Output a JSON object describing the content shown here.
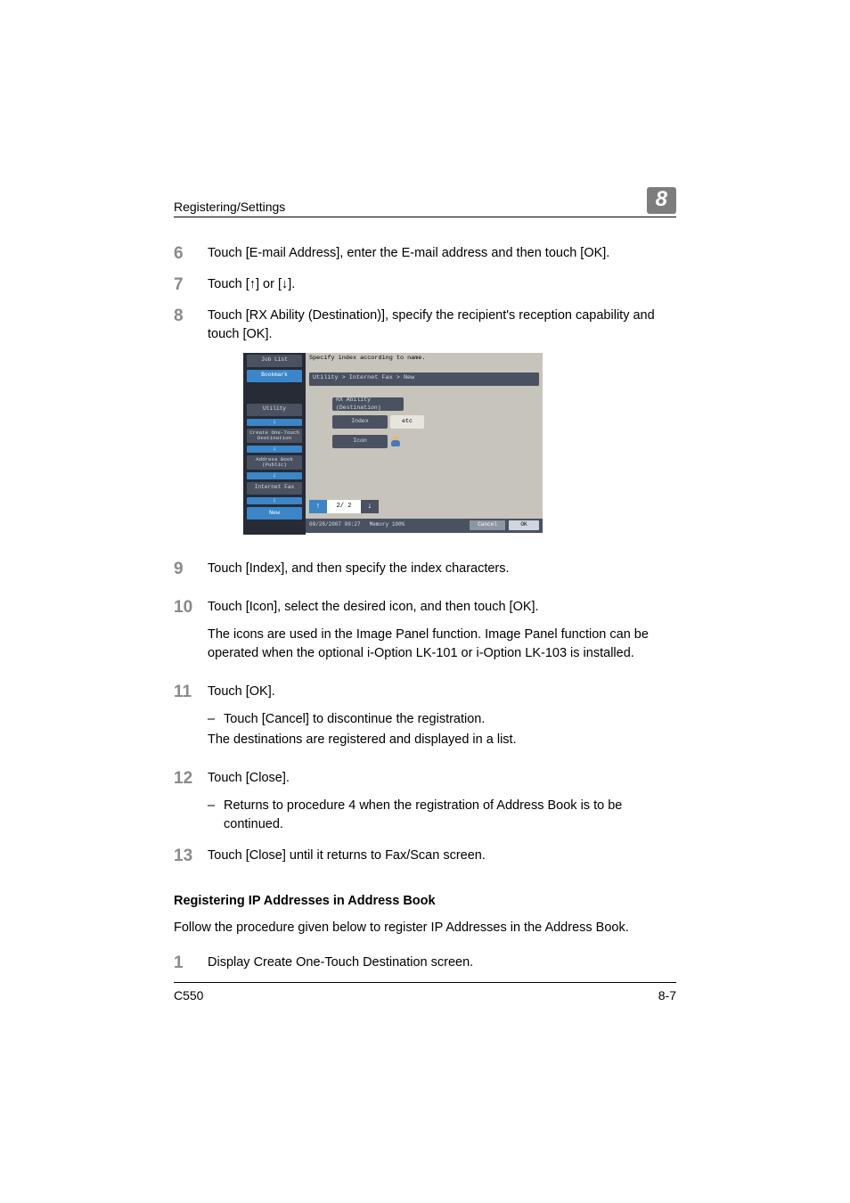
{
  "header": {
    "section_title": "Registering/Settings",
    "chapter_number": "8"
  },
  "steps_a": [
    {
      "num": "6",
      "text": "Touch [E-mail Address], enter the E-mail address and then touch [OK]."
    },
    {
      "num": "7",
      "text": "Touch [↑] or [↓]."
    },
    {
      "num": "8",
      "text": "Touch [RX Ability (Destination)], specify the recipient's reception capability and touch [OK]."
    }
  ],
  "device_screen": {
    "sidebar": {
      "job_list": "Job List",
      "bookmark": "Bookmark",
      "utility": "Utility",
      "create_one_touch": "Create One-Touch Destination",
      "address_book": "Address Book (Public)",
      "internet_fax": "Internet Fax",
      "new": "New"
    },
    "top_message": "Specify index according to name.",
    "breadcrumb": "Utility > Internet Fax > New",
    "rx_ability_label": "RX Ability (Destination)",
    "index_label": "Index",
    "index_value": "etc",
    "icon_label": "Icon",
    "page_indicator": "2/ 2",
    "timestamp": "09/28/2007   09:27",
    "memory": "Memory        100%",
    "cancel": "Cancel",
    "ok": "OK"
  },
  "steps_b": [
    {
      "num": "9",
      "paras": [
        "Touch [Index], and then specify the index characters."
      ]
    },
    {
      "num": "10",
      "paras": [
        "Touch [Icon], select the desired icon, and then touch [OK].",
        "The icons are used in the Image Panel function. Image Panel function can be operated when the optional i-Option LK-101 or i-Option LK-103 is installed."
      ]
    },
    {
      "num": "11",
      "paras": [
        "Touch [OK]."
      ],
      "subs": [
        "Touch [Cancel] to discontinue the registration."
      ],
      "trailing": "The destinations are registered and displayed in a list."
    },
    {
      "num": "12",
      "paras": [
        "Touch [Close]."
      ],
      "subs": [
        "Returns to procedure 4 when the registration of Address Book is to be continued."
      ]
    },
    {
      "num": "13",
      "paras": [
        "Touch [Close] until it returns to Fax/Scan screen."
      ]
    }
  ],
  "section": {
    "heading": "Registering IP Addresses in Address Book",
    "intro": "Follow the procedure given below to register IP Addresses in the Address Book."
  },
  "steps_c": [
    {
      "num": "1",
      "text": "Display Create One-Touch Destination screen."
    }
  ],
  "footer": {
    "model": "C550",
    "page": "8-7"
  }
}
